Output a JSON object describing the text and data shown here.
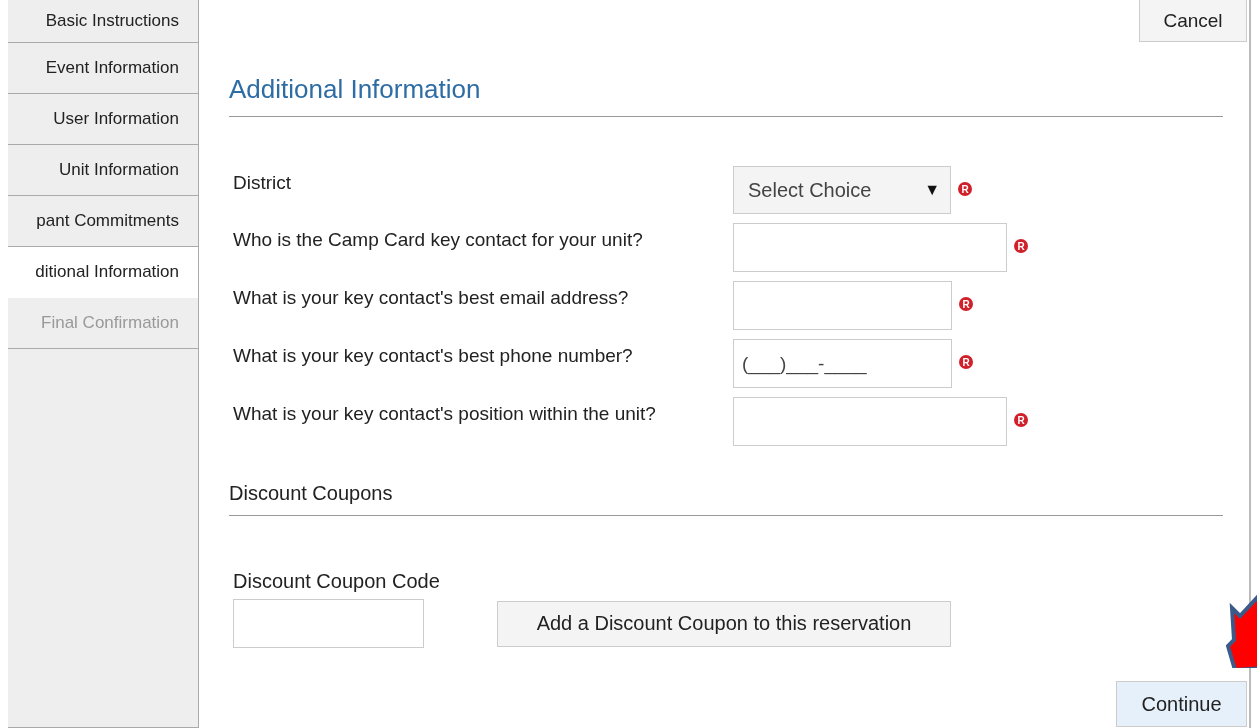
{
  "sidebar": {
    "items": [
      {
        "label": "Basic Instructions",
        "selected": false,
        "disabled": false
      },
      {
        "label": "Event Information",
        "selected": false,
        "disabled": false
      },
      {
        "label": "User Information",
        "selected": false,
        "disabled": false
      },
      {
        "label": "Unit Information",
        "selected": false,
        "disabled": false
      },
      {
        "label": "pant Commitments",
        "selected": false,
        "disabled": false
      },
      {
        "label": "ditional Information",
        "selected": true,
        "disabled": false
      },
      {
        "label": "Final Confirmation",
        "selected": false,
        "disabled": true
      }
    ]
  },
  "cancel_button": "Cancel",
  "section_title": "Additional Information",
  "fields": [
    {
      "kind": "select",
      "label": "District",
      "value": "Select Choice",
      "caret": "▼",
      "required": true,
      "required_mark": "R"
    },
    {
      "kind": "widetext",
      "label": "Who is the Camp Card key contact for your unit?",
      "required": true,
      "required_mark": "R"
    },
    {
      "kind": "text",
      "label": "What is your key contact's best email address?",
      "required": true,
      "required_mark": "R"
    },
    {
      "kind": "text",
      "label": "What is your key contact's best phone number?",
      "placeholder": "(___)___-____",
      "required": true,
      "required_mark": "R"
    },
    {
      "kind": "widetext",
      "label": "What is your key contact's position within the unit?",
      "required": true,
      "required_mark": "R"
    }
  ],
  "discount": {
    "title": "Discount Coupons",
    "code_label": "Discount Coupon Code",
    "add_button": "Add a Discount Coupon to this reservation"
  },
  "continue_button": "Continue"
}
